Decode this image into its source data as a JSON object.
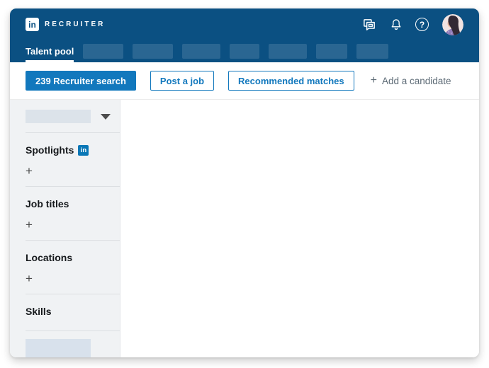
{
  "header": {
    "logo_badge": "in",
    "product_name": "RECRUITER",
    "help_glyph": "?"
  },
  "tabs": {
    "active_label": "Talent pool"
  },
  "action_bar": {
    "recruiter_search_label": "239 Recruiter search",
    "post_job_label": "Post a job",
    "recommended_matches_label": "Recommended matches",
    "add_candidate_plus": "+",
    "add_candidate_label": "Add a candidate"
  },
  "sidebar": {
    "sections": [
      {
        "label": "Spotlights",
        "badge": "in",
        "add_label": "+"
      },
      {
        "label": "Job titles",
        "add_label": "+"
      },
      {
        "label": "Locations",
        "add_label": "+"
      },
      {
        "label": "Skills"
      }
    ]
  },
  "colors": {
    "header_blue": "#0b5082",
    "brand_blue": "#1278bd",
    "linkedin_badge_blue": "#0a77b6",
    "sidebar_bg": "#f0f2f4",
    "placeholder_blue_gray": "#dce3ea"
  }
}
